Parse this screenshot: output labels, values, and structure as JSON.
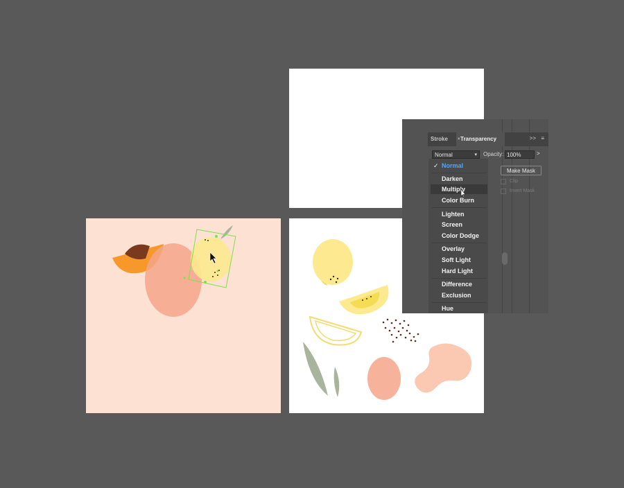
{
  "panel": {
    "tabs": [
      {
        "label": "Stroke"
      },
      {
        "label": "Transparency",
        "close": "×"
      }
    ],
    "more_glyph": ">>",
    "menu_glyph": "≡",
    "blend_mode_value": "Normal",
    "opacity_label": "Opacity:",
    "opacity_value": "100%",
    "opacity_arrow": ">",
    "make_mask_label": "Make Mask",
    "clip_label": "Clip",
    "invert_mask_label": "Invert Mask"
  },
  "blend_menu": {
    "check_glyph": "✓",
    "items": [
      {
        "label": "Normal",
        "selected": true
      },
      {
        "label": "Darken"
      },
      {
        "label": "Multiply",
        "hovered": true
      },
      {
        "label": "Color Burn"
      },
      {
        "label": "Lighten"
      },
      {
        "label": "Screen"
      },
      {
        "label": "Color Dodge"
      },
      {
        "label": "Overlay"
      },
      {
        "label": "Soft Light"
      },
      {
        "label": "Hard Light"
      },
      {
        "label": "Difference"
      },
      {
        "label": "Exclusion"
      },
      {
        "label": "Hue"
      }
    ]
  },
  "colors": {
    "canvas_bg": "#595959",
    "peach_artboard": "#fde1d3",
    "selection_green": "#7de04a",
    "menu_selected": "#59a4f2",
    "orange": "#f59321",
    "lemon_yellow": "#fde98f",
    "salmon": "#f4a58a",
    "leaf_green": "#a9b49d"
  }
}
